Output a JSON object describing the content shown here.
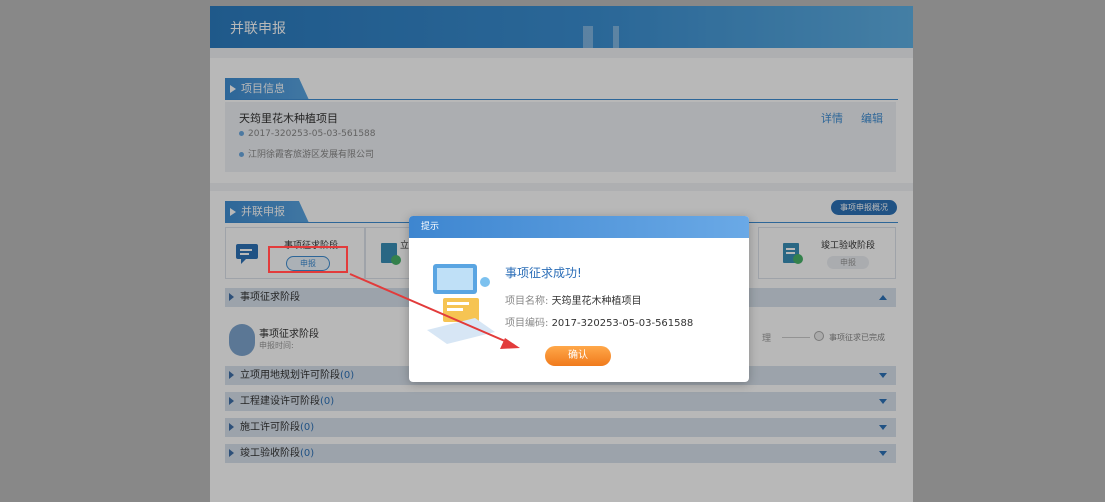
{
  "header": {
    "title": "并联申报"
  },
  "project": {
    "tab_label": "项目信息",
    "name": "天筠里花木种植项目",
    "code": "2017-320253-05-03-561588",
    "company": "江阴徐霞客旅游区发展有限公司",
    "detail_link": "详情",
    "edit_link": "编辑"
  },
  "parallel": {
    "tab_label": "并联申报",
    "overview_button": "事项申报概况",
    "stages": [
      {
        "name": "事项征求阶段",
        "button": "申报"
      },
      {
        "name": "立",
        "button": ""
      },
      {
        "name": "竣工验收阶段",
        "button": "申报"
      }
    ]
  },
  "accordion": [
    {
      "label": "事项征求阶段",
      "count": "",
      "expanded": true
    },
    {
      "label": "立项用地规划许可阶段",
      "count": "(0)",
      "expanded": false
    },
    {
      "label": "工程建设许可阶段",
      "count": "(0)",
      "expanded": false
    },
    {
      "label": "施工许可阶段",
      "count": "(0)",
      "expanded": false
    },
    {
      "label": "竣工验收阶段",
      "count": "(0)",
      "expanded": false
    }
  ],
  "stage_detail": {
    "title": "事项征求阶段",
    "time_label": "申报时间:",
    "mid_text": "理",
    "status": "事项征求已完成"
  },
  "modal": {
    "header": "提示",
    "title": "事项征求成功!",
    "name_key": "项目名称:",
    "name_val": "天筠里花木种植项目",
    "code_key": "项目编码:",
    "code_val": "2017-320253-05-03-561588",
    "confirm": "确认"
  },
  "colors": {
    "accent": "#3f8ed3",
    "confirm": "#f28a2c",
    "highlight": "#e23b3b"
  }
}
